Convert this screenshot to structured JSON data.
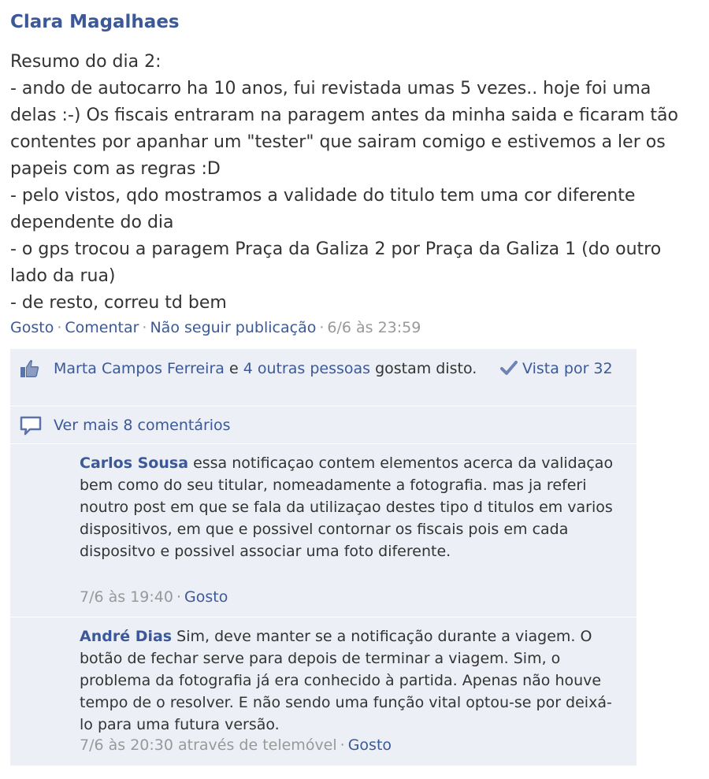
{
  "post": {
    "author": "Clara Magalhaes",
    "body": "Resumo do dia 2:\n- ando de autocarro ha 10 anos, fui revistada umas 5 vezes.. hoje foi uma delas :-) Os fiscais entraram na paragem antes da minha saida e ficaram tão contentes por apanhar um \"tester\" que sairam comigo e estivemos a ler os papeis com as regras :D\n- pelo vistos, qdo mostramos a validade do titulo tem uma cor diferente dependente do dia\n- o gps trocou a paragem Praça da Galiza 2 por Praça da Galiza 1 (do outro lado da rua)\n- de resto, correu td bem",
    "actions": {
      "like": "Gosto",
      "comment": "Comentar",
      "unfollow": "Não seguir publicação",
      "timestamp": "6/6 às 23:59",
      "separator": "·"
    }
  },
  "likes": {
    "first_liker": "Marta Campos Ferreira",
    "conjunction": " e ",
    "others": "4 outras pessoas",
    "suffix": " gostam disto.",
    "seen_by": "Vista por 32",
    "icons": [
      "thumbs-up-icon",
      "checkmark-icon"
    ]
  },
  "more_comments": {
    "label": "Ver mais 8 comentários",
    "icon": "speech-bubble-icon"
  },
  "comments": [
    {
      "author": "Carlos Sousa",
      "text": " essa notificaçao contem elementos acerca da validaçao bem como do seu titular, nomeadamente a fotografia. mas ja referi noutro post em que se fala da utilizaçao destes tipo d titulos em varios dispositivos, em que e possivel contornar os fiscais pois em cada dispositvo e possivel associar uma foto diferente.",
      "timestamp": "7/6 às 19:40",
      "like": "Gosto"
    },
    {
      "author": "André Dias",
      "text": " Sim, deve manter se a notificação durante a viagem. O botão de fechar serve para depois de terminar a viagem. Sim, o problema da fotografia já era conhecido à partida. Apenas não houve tempo de o resolver. E não sendo uma função vital optou-se por deixá-lo para uma futura versão.",
      "timestamp": "7/6 às 20:30 através de telemóvel",
      "like": "Gosto"
    }
  ],
  "colors": {
    "link": "#3b5998",
    "text": "#333333",
    "muted": "#999999",
    "ufi_background": "#eceff5"
  }
}
